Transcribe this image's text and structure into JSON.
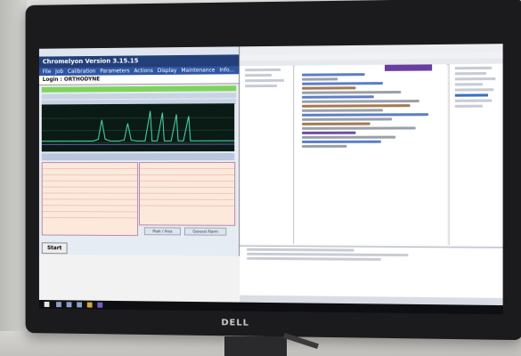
{
  "left_app": {
    "title_bar": "",
    "header": "Chromelyon Version 3.15.15",
    "menu": [
      "File",
      "Job",
      "Calibration",
      "Parameters",
      "Actions",
      "Display",
      "Maintenance",
      "Info..."
    ],
    "login": "Login : ORTHODYNE",
    "start_button": "Start",
    "buttons": [
      "Peak / Area",
      "General Alarm"
    ]
  },
  "brand": {
    "logo": "DELL"
  }
}
